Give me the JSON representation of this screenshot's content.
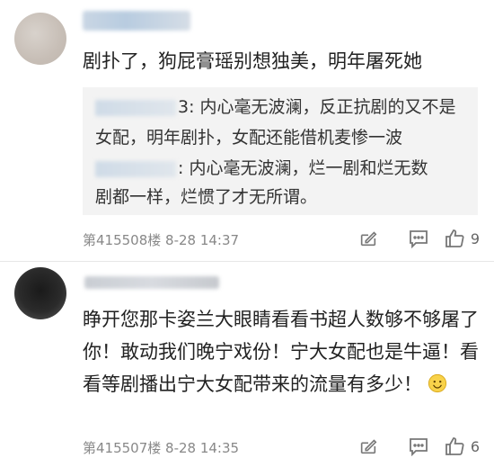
{
  "comments": [
    {
      "text": "剧扑了，狗屁膏瑶别想独美，明年屠死她",
      "quote": {
        "line1_suffix": "3: 内心毫无波澜，反正抗剧的又不是",
        "line2": "女配，明年剧扑，女配还能借机麦惨一波",
        "line3_suffix": ": 内心毫无波澜，烂一剧和烂无数",
        "line4": "剧都一样，烂惯了才无所谓。"
      },
      "meta": "第415508楼  8-28 14:37",
      "likes": "9"
    },
    {
      "text": "睁开您那卡姿兰大眼睛看看书超人数够不够屠了你！敢动我们晚宁戏份！宁大女配也是牛逼！看看等剧播出宁大女配带来的流量有多少！",
      "meta": "第415507楼  8-28 14:35",
      "likes": "6"
    }
  ],
  "icons": {
    "edit": "edit-icon",
    "comment": "comment-icon",
    "like": "thumbs-up-icon",
    "emoji": "smiley-emoji-icon"
  }
}
